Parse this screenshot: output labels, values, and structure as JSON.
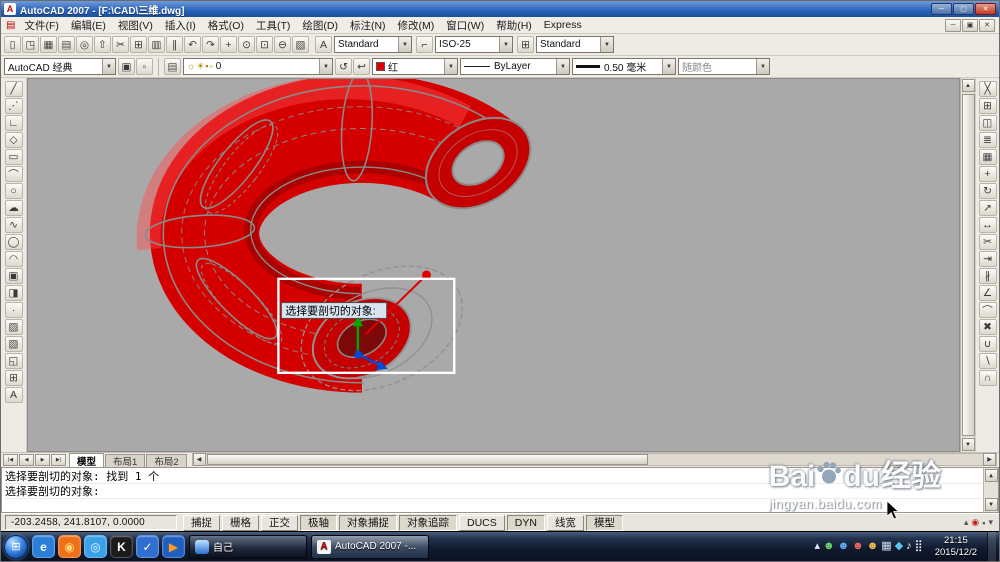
{
  "colors": {
    "model_red": "#d40000",
    "layer_color_red": "#e00000",
    "canvas_gray": "#a9a9a9",
    "titlebar_blue": "#2a62b9",
    "selection_box_white": "#ffffff"
  },
  "titlebar": {
    "app_icon_glyph": "A",
    "title": "AutoCAD 2007 - [F:\\CAD\\三维.dwg]",
    "controls": [
      {
        "name": "minimize-button",
        "glyph": "─"
      },
      {
        "name": "maximize-button",
        "glyph": "▢"
      },
      {
        "name": "close-button",
        "glyph": "✕",
        "cls": "close"
      }
    ]
  },
  "menubar": {
    "doc_icon_glyph": "▤",
    "items": [
      "文件(F)",
      "编辑(E)",
      "视图(V)",
      "插入(I)",
      "格式(O)",
      "工具(T)",
      "绘图(D)",
      "标注(N)",
      "修改(M)",
      "窗口(W)",
      "帮助(H)",
      "Express"
    ],
    "child_controls": [
      {
        "name": "mdi-minimize-button",
        "glyph": "─"
      },
      {
        "name": "mdi-restore-button",
        "glyph": "▣"
      },
      {
        "name": "mdi-close-button",
        "glyph": "✕"
      }
    ]
  },
  "toolbar_standard": {
    "icons": [
      {
        "name": "new-icon",
        "glyph": "▯"
      },
      {
        "name": "open-icon",
        "glyph": "◳"
      },
      {
        "name": "save-icon",
        "glyph": "▦"
      },
      {
        "name": "plot-icon",
        "glyph": "▤"
      },
      {
        "name": "plot-preview-icon",
        "glyph": "◎"
      },
      {
        "name": "publish-icon",
        "glyph": "⇧"
      },
      {
        "name": "cut-icon",
        "glyph": "✂"
      },
      {
        "name": "copy-icon",
        "glyph": "⊞"
      },
      {
        "name": "paste-icon",
        "glyph": "▥"
      },
      {
        "name": "match-properties-icon",
        "glyph": "∥"
      },
      {
        "name": "undo-icon",
        "glyph": "↶"
      },
      {
        "name": "redo-icon",
        "glyph": "↷"
      },
      {
        "name": "pan-icon",
        "glyph": "+"
      },
      {
        "name": "zoom-realtime-icon",
        "glyph": "⊙"
      },
      {
        "name": "zoom-window-icon",
        "glyph": "⊡"
      },
      {
        "name": "zoom-previous-icon",
        "glyph": "⊖"
      },
      {
        "name": "properties-icon",
        "glyph": "▧"
      }
    ],
    "style_combos": [
      {
        "name": "text-style-combo",
        "icon_glyph": "A",
        "value": "Standard"
      },
      {
        "name": "dim-style-combo",
        "icon_glyph": "⌐",
        "value": "ISO-25"
      },
      {
        "name": "table-style-combo",
        "icon_glyph": "⊞",
        "value": "Standard"
      }
    ]
  },
  "toolbar_properties": {
    "workspace_value": "AutoCAD 经典",
    "workspace_icons": [
      {
        "name": "workspace-settings-icon",
        "glyph": "▣"
      },
      {
        "name": "toolbar-lock-icon",
        "glyph": "▫"
      }
    ],
    "layer_icon_glyph": "▤",
    "layer_status_glyphs": [
      "☼",
      "☀",
      "▪",
      "▫"
    ],
    "layer_value": "0",
    "layer_extra_icons": [
      {
        "name": "make-object-layer-current-icon",
        "glyph": "↺"
      },
      {
        "name": "layer-previous-icon",
        "glyph": "↩"
      }
    ],
    "color_value": "红",
    "linetype_value": "ByLayer",
    "lineweight_value": "0.50 毫米",
    "plotstyle_value": "随颜色"
  },
  "draw_toolbar": {
    "icons": [
      {
        "name": "line-icon",
        "glyph": "╱"
      },
      {
        "name": "construction-line-icon",
        "glyph": "⋰"
      },
      {
        "name": "polyline-icon",
        "glyph": "∟"
      },
      {
        "name": "polygon-icon",
        "glyph": "◇"
      },
      {
        "name": "rectangle-icon",
        "glyph": "▭"
      },
      {
        "name": "arc-icon",
        "glyph": "⌒"
      },
      {
        "name": "circle-icon",
        "glyph": "○"
      },
      {
        "name": "revision-cloud-icon",
        "glyph": "☁"
      },
      {
        "name": "spline-icon",
        "glyph": "∿"
      },
      {
        "name": "ellipse-icon",
        "glyph": "◯"
      },
      {
        "name": "ellipse-arc-icon",
        "glyph": "◠"
      },
      {
        "name": "insert-block-icon",
        "glyph": "▣"
      },
      {
        "name": "make-block-icon",
        "glyph": "◨"
      },
      {
        "name": "point-icon",
        "glyph": "·"
      },
      {
        "name": "hatch-icon",
        "glyph": "▨"
      },
      {
        "name": "gradient-icon",
        "glyph": "▧"
      },
      {
        "name": "region-icon",
        "glyph": "◱"
      },
      {
        "name": "table-icon",
        "glyph": "⊞"
      },
      {
        "name": "multiline-text-icon",
        "glyph": "A"
      }
    ]
  },
  "modify_toolbar": {
    "icons": [
      {
        "name": "erase-icon",
        "glyph": "╳"
      },
      {
        "name": "copy-object-icon",
        "glyph": "⊞"
      },
      {
        "name": "mirror-icon",
        "glyph": "◫"
      },
      {
        "name": "offset-icon",
        "glyph": "≣"
      },
      {
        "name": "array-icon",
        "glyph": "▦"
      },
      {
        "name": "move-icon",
        "glyph": "+"
      },
      {
        "name": "rotate-icon",
        "glyph": "↻"
      },
      {
        "name": "scale-icon",
        "glyph": "↗"
      },
      {
        "name": "stretch-icon",
        "glyph": "↔"
      },
      {
        "name": "trim-icon",
        "glyph": "✂"
      },
      {
        "name": "extend-icon",
        "glyph": "⇥"
      },
      {
        "name": "break-icon",
        "glyph": "∦"
      },
      {
        "name": "chamfer-icon",
        "glyph": "∠"
      },
      {
        "name": "fillet-icon",
        "glyph": "⌒"
      },
      {
        "name": "explode-icon",
        "glyph": "✖"
      },
      {
        "name": "union-icon",
        "glyph": "∪"
      },
      {
        "name": "subtract-icon",
        "glyph": "∖"
      },
      {
        "name": "intersect-icon",
        "glyph": "∩"
      }
    ]
  },
  "canvas": {
    "tooltip": "选择要剖切的对象:",
    "tabs": [
      {
        "label": "模型",
        "active": true
      },
      {
        "label": "布局1",
        "active": false
      },
      {
        "label": "布局2",
        "active": false
      }
    ]
  },
  "command": {
    "lines": [
      "选择要剖切的对象: 找到 1 个",
      "选择要剖切的对象:"
    ]
  },
  "statusbar": {
    "coords": "-203.2458, 241.8107, 0.0000",
    "toggles": [
      {
        "label": "捕捉",
        "pressed": false
      },
      {
        "label": "栅格",
        "pressed": false
      },
      {
        "label": "正交",
        "pressed": false
      },
      {
        "label": "极轴",
        "pressed": true
      },
      {
        "label": "对象捕捉",
        "pressed": true
      },
      {
        "label": "对象追踪",
        "pressed": true
      },
      {
        "label": "DUCS",
        "pressed": false
      },
      {
        "label": "DYN",
        "pressed": true
      },
      {
        "label": "线宽",
        "pressed": false
      },
      {
        "label": "模型",
        "pressed": true
      }
    ],
    "right_icons": [
      {
        "name": "annotation-scale-icon",
        "glyph": "▴"
      },
      {
        "name": "communication-center-icon",
        "glyph": "◉",
        "color": "#c22211"
      },
      {
        "name": "toolbar-lock-icon",
        "glyph": "▪"
      },
      {
        "name": "status-menu-icon",
        "glyph": "▾"
      }
    ]
  },
  "taskbar": {
    "start_glyph": "⊞",
    "quick_launch": [
      {
        "name": "ie-browser-icon",
        "glyph": "e",
        "bg": "#2a7fd8",
        "color": "#ffffff"
      },
      {
        "name": "firefox-icon",
        "glyph": "◉",
        "bg": "#f07018",
        "color": "#ffd77a"
      },
      {
        "name": "chrome-browser-icon",
        "glyph": "◎",
        "bg": "#3aa0e8",
        "color": "#eaf4ff"
      },
      {
        "name": "kugou-music-icon",
        "glyph": "K",
        "bg": "#1b1b1b",
        "color": "#ffffff"
      },
      {
        "name": "security-shield-icon",
        "glyph": "✓",
        "bg": "#2e6fd0",
        "color": "#ffffff"
      },
      {
        "name": "media-player-icon",
        "glyph": "▶",
        "bg": "#1f5fc0",
        "color": "#ff9a20"
      }
    ],
    "windows": {
      "qq": {
        "label": "自己"
      },
      "autocad": {
        "label": "AutoCAD 2007 -...",
        "icon_glyph": "A"
      }
    },
    "tray_icons": [
      {
        "name": "tray-up-arrow-icon",
        "glyph": "▴",
        "color": "#dfe8f2"
      },
      {
        "name": "tray-user-green-icon",
        "glyph": "☻",
        "color": "#6fd66f"
      },
      {
        "name": "tray-user-blue-icon",
        "glyph": "☻",
        "color": "#5fb0f0"
      },
      {
        "name": "tray-user-red-icon",
        "glyph": "☻",
        "color": "#e86a5a"
      },
      {
        "name": "tray-user-yellow-icon",
        "glyph": "☻",
        "color": "#f0c050"
      },
      {
        "name": "tray-message-icon",
        "glyph": "▦",
        "color": "#cfe0ee"
      },
      {
        "name": "tray-safety-icon",
        "glyph": "◆",
        "color": "#58c8e8"
      },
      {
        "name": "volume-icon",
        "glyph": "♪",
        "color": "#ffffff"
      },
      {
        "name": "network-icon",
        "glyph": "⣿",
        "color": "#ffffff"
      }
    ],
    "clock": {
      "time": "21:15",
      "date": "2015/12/2"
    }
  },
  "watermark": {
    "bai": "Bai",
    "du": "du",
    "suffix": "经验",
    "url": "jingyan.baidu.com"
  }
}
